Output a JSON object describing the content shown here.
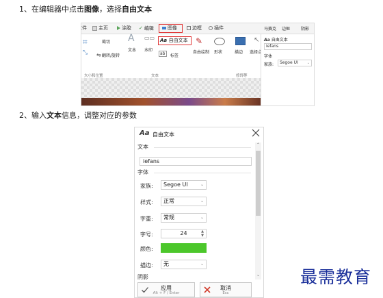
{
  "step1": {
    "prefix": "1、在编辑器中点击",
    "bold1": "图像",
    "middle": "，选择",
    "bold2": "自由文本"
  },
  "step2": {
    "prefix": "2、输入",
    "bold1": "文本",
    "rest": "信息，调整对应的参数"
  },
  "ribbon": {
    "tabs": [
      "文件",
      "主页",
      "涂胶",
      "编辑",
      "图像",
      "边框",
      "插件"
    ],
    "active_tab": "图像",
    "tools": {
      "crop": "裁切",
      "flip_rotate": "翻转/旋转",
      "text": "文本",
      "watermark": "水印",
      "free_text": "自由文本",
      "tag": "标签",
      "auto_fill": "自由绘制",
      "shapes": "形状",
      "stroke": "描边",
      "select_point": "选择点击",
      "mosaic": "马赛克",
      "border": "边框",
      "shadow": "阴影"
    },
    "groups": [
      "大小和位置",
      "文本",
      "修饰等"
    ],
    "side": {
      "title": "自由文本",
      "input_value": "iefans",
      "font_section": "字体",
      "family_label": "家族:",
      "family_value": "Segoe UI"
    }
  },
  "panel": {
    "title_icon": "Aa",
    "title": "自由文本",
    "text_section": "文本",
    "text_value": "iefans",
    "font_section": "字体",
    "rows": [
      {
        "label": "家族:",
        "value": "Segoe UI"
      },
      {
        "label": "样式:",
        "value": "正常"
      },
      {
        "label": "字重:",
        "value": "常规"
      },
      {
        "label": "字号:",
        "value": "24"
      },
      {
        "label": "颜色:",
        "value": ""
      },
      {
        "label": "描边:",
        "value": "无"
      }
    ],
    "color_value": "#4cc72b",
    "shadow_section": "阴影",
    "apply_label": "应用",
    "apply_shortcut": "Alt + F / Enter",
    "cancel_label": "取消",
    "cancel_shortcut": "Esc"
  },
  "watermark": "最需教育",
  "colors": {
    "highlight_border": "#e03030",
    "text_color_swatch": "#4cc72b",
    "watermark": "#1a2f9a"
  }
}
